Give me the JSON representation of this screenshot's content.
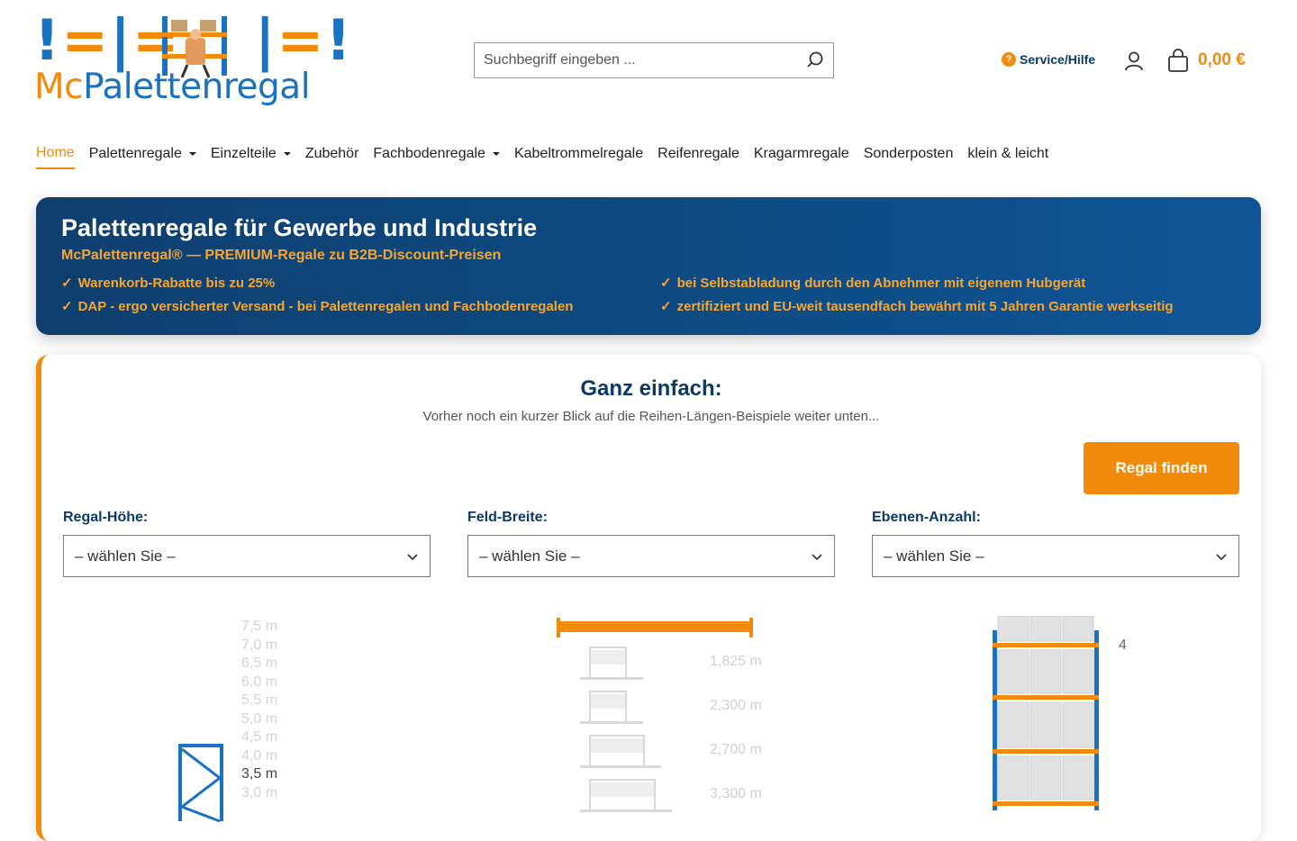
{
  "header": {
    "logo_text_mc": "Mc",
    "logo_text_rest": "Palettenregal",
    "logo_marks": "!=|=|=!",
    "search_placeholder": "Suchbegriff eingeben ...",
    "service_label": "Service/Hilfe",
    "cart_total": "0,00 €"
  },
  "nav": [
    {
      "label": "Home",
      "active": true,
      "dropdown": false
    },
    {
      "label": "Palettenregale",
      "dropdown": true
    },
    {
      "label": "Einzelteile",
      "dropdown": true
    },
    {
      "label": "Zubehör",
      "dropdown": false
    },
    {
      "label": "Fachbodenregale",
      "dropdown": true
    },
    {
      "label": "Kabeltrommelregale",
      "dropdown": false
    },
    {
      "label": "Reifenregale",
      "dropdown": false
    },
    {
      "label": "Kragarmregale",
      "dropdown": false
    },
    {
      "label": "Sonderposten",
      "dropdown": false
    },
    {
      "label": "klein & leicht",
      "dropdown": false
    }
  ],
  "banner": {
    "title": "Palettenregale für Gewerbe und Industrie",
    "subtitle": "McPalettenregal® — PREMIUM-Regale zu B2B-Discount-Preisen",
    "points": [
      "Warenkorb-Rabatte bis zu 25%",
      "bei Selbstabladung durch den Abnehmer mit eigenem Hubgerät",
      "DAP - ergo versicherter Versand - bei Palettenregalen und Fachbodenregalen",
      "zertifiziert und EU-weit tausendfach bewährt mit 5 Jahren Garantie werkseitig"
    ],
    "check_glyph": "✓"
  },
  "configurator": {
    "title": "Ganz einfach:",
    "hint": "Vorher noch ein kurzer Blick auf die Reihen-Längen-Beispiele weiter unten...",
    "find_button": "Regal finden",
    "selects": [
      {
        "label": "Regal-Höhe:",
        "value": "– wählen Sie –"
      },
      {
        "label": "Feld-Breite:",
        "value": "– wählen Sie –"
      },
      {
        "label": "Ebenen-Anzahl:",
        "value": "– wählen Sie –"
      }
    ],
    "heights": [
      "7,5 m",
      "7,0 m",
      "6,5 m",
      "6,0 m",
      "5,5 m",
      "5,0 m",
      "4,5 m",
      "4,0 m",
      "3,5 m",
      "3,0 m"
    ],
    "highlighted_height": "3,5 m",
    "widths": [
      "1,825 m",
      "2,300 m",
      "2,700 m",
      "3,300 m"
    ],
    "levels_count": "4"
  },
  "colors": {
    "brand_blue": "#1a72c0",
    "brand_orange": "#f28b0c",
    "navy": "#0b3a67"
  }
}
